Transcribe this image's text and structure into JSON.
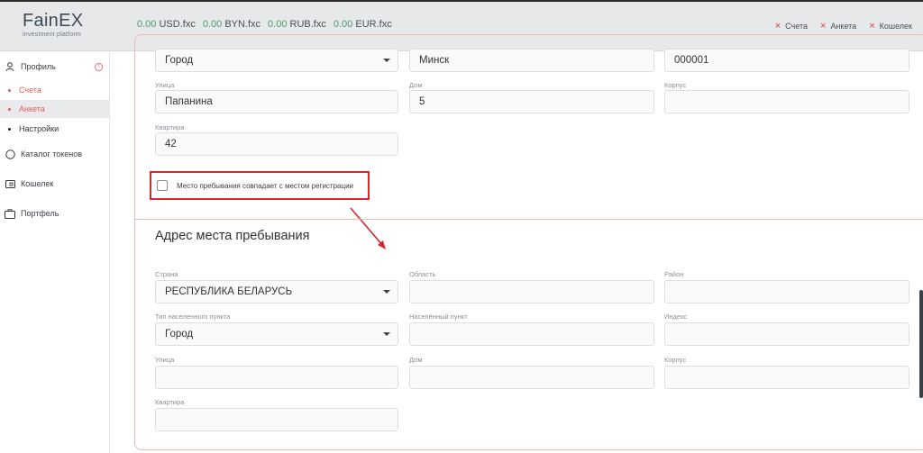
{
  "header": {
    "logo": "FainEX",
    "logo_sub": "investment platform",
    "balances": [
      {
        "value": "0.00",
        "currency": "USD.fxc"
      },
      {
        "value": "0.00",
        "currency": "BYN.fxc"
      },
      {
        "value": "0.00",
        "currency": "RUB.fxc"
      },
      {
        "value": "0.00",
        "currency": "EUR.fxc"
      }
    ],
    "links": [
      "Счета",
      "Анкета",
      "Кошелек"
    ]
  },
  "sidebar": {
    "profile": "Профиль",
    "sub_items": [
      {
        "label": "Счета",
        "color": "#e55b5b"
      },
      {
        "label": "Анкета",
        "color": "#e55b5b"
      },
      {
        "label": "Настройки",
        "color": "#222222"
      }
    ],
    "items": [
      "Каталог токенов",
      "Кошелек",
      "Портфель"
    ]
  },
  "registration": {
    "city_type_value": "Город",
    "settlement_value": "Минск",
    "postcode_value": "000001",
    "street_label": "Улица",
    "street_value": "Папанина",
    "house_label": "Дом",
    "house_value": "5",
    "building_label": "Корпус",
    "building_value": "",
    "apartment_label": "Квартира",
    "apartment_value": "42"
  },
  "same_address_checkbox": {
    "label": "Место пребывания совпадает с местом регистрации",
    "checked": false
  },
  "stay_address": {
    "title": "Адрес места пребывания",
    "country_label": "Страна",
    "country_value": "РЕСПУБЛИКА БЕЛАРУСЬ",
    "region_label": "Область",
    "region_value": "",
    "district_label": "Район",
    "district_value": "",
    "settlement_type_label": "Тип населенного пункта",
    "settlement_type_value": "Город",
    "settlement_label": "Населённый пункт",
    "settlement_value": "",
    "index_label": "Индекс",
    "index_value": "",
    "street_label": "Улица",
    "street_value": "",
    "house_label": "Дом",
    "house_value": "",
    "building_label": "Корпус",
    "building_value": "",
    "apartment_label": "Квартира",
    "apartment_value": ""
  },
  "colors": {
    "accent_red": "#d9262c",
    "balance_green": "#4d9a6c",
    "card_border": "#f0b7b7"
  }
}
